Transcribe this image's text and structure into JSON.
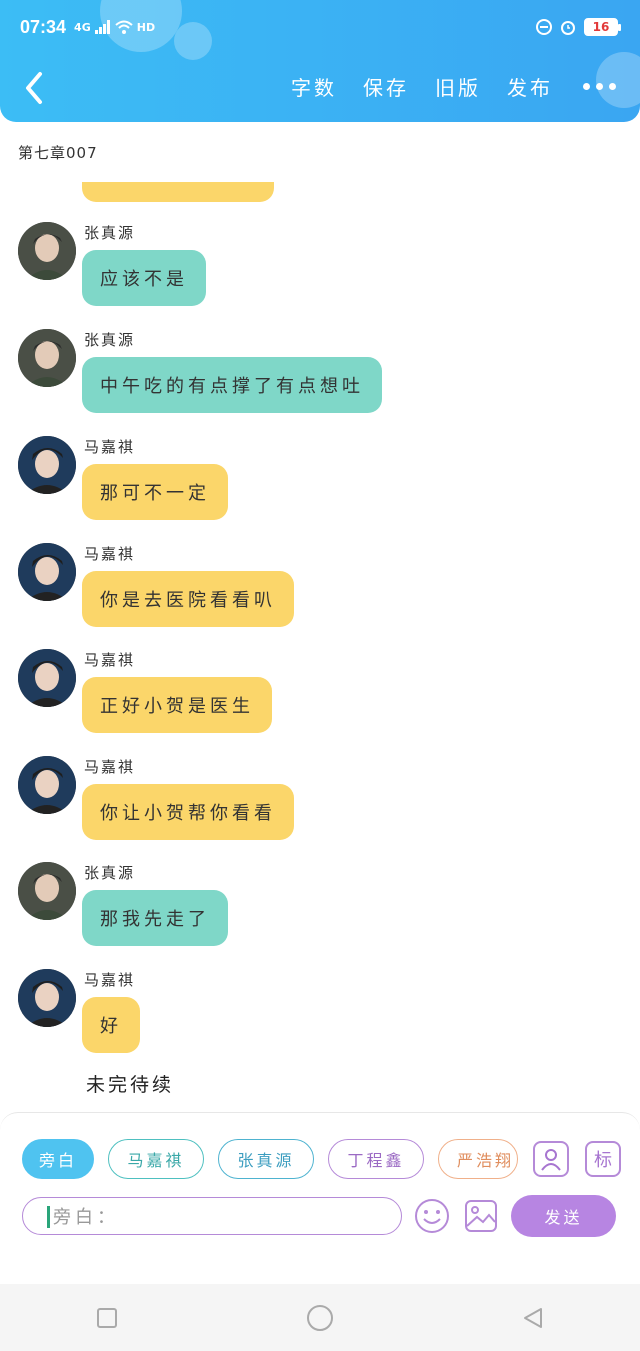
{
  "status": {
    "time": "07:34",
    "network": "4G",
    "hd": "HD",
    "battery": "16"
  },
  "header": {
    "actions": [
      "字数",
      "保存",
      "旧版",
      "发布"
    ],
    "colors": {
      "bar": "#3cbdf5"
    }
  },
  "chapter_title": "第七章007",
  "messages": [
    {
      "sender": "张真源",
      "text": "应该不是",
      "style": "teal"
    },
    {
      "sender": "张真源",
      "text": "中午吃的有点撑了有点想吐",
      "style": "teal"
    },
    {
      "sender": "马嘉祺",
      "text": "那可不一定",
      "style": "yellow"
    },
    {
      "sender": "马嘉祺",
      "text": "你是去医院看看叭",
      "style": "yellow"
    },
    {
      "sender": "马嘉祺",
      "text": "正好小贺是医生",
      "style": "yellow"
    },
    {
      "sender": "马嘉祺",
      "text": "你让小贺帮你看看",
      "style": "yellow"
    },
    {
      "sender": "张真源",
      "text": "那我先走了",
      "style": "teal"
    },
    {
      "sender": "马嘉祺",
      "text": "好",
      "style": "yellow"
    }
  ],
  "tbc_text": "未完待续",
  "composer": {
    "chips": [
      "旁白",
      "马嘉祺",
      "张真源",
      "丁程鑫",
      "严浩翔"
    ],
    "tag_icon_label": "标",
    "input_placeholder": "旁白：",
    "send_label": "发送"
  },
  "icons": {
    "back": "back-arrow-icon",
    "more": "more-dots-icon",
    "avatar_manage": "person-icon",
    "emoji": "smiley-icon",
    "image": "image-icon",
    "nav": [
      "square-icon",
      "circle-icon",
      "triangle-back-icon"
    ]
  }
}
